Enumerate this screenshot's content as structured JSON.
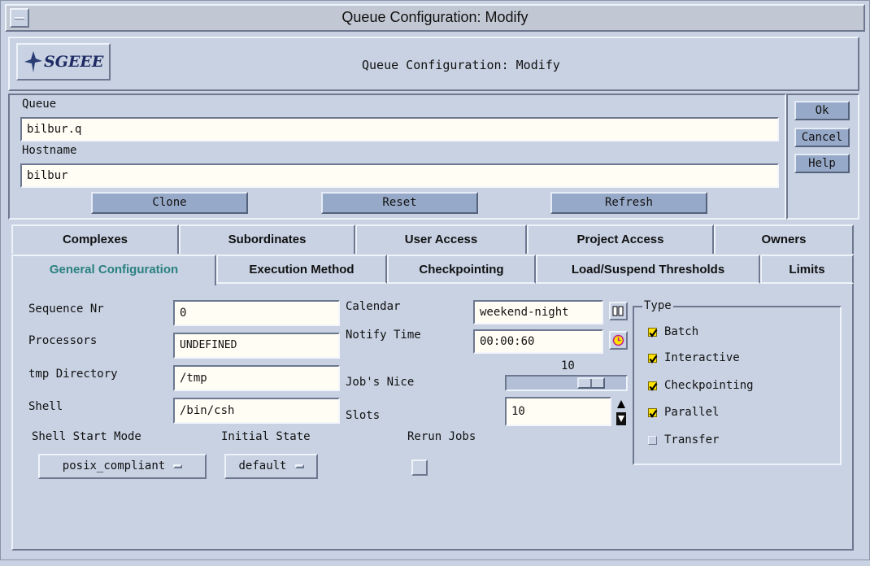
{
  "window": {
    "title": "Queue Configuration: Modify"
  },
  "header": {
    "logo_text": "SGEEE",
    "title": "Queue Configuration: Modify"
  },
  "form": {
    "queue_label": "Queue",
    "queue_value": "bilbur.q",
    "hostname_label": "Hostname",
    "hostname_value": "bilbur"
  },
  "form_buttons": {
    "clone": "Clone",
    "reset": "Reset",
    "refresh": "Refresh"
  },
  "side_buttons": {
    "ok": "Ok",
    "cancel": "Cancel",
    "help": "Help"
  },
  "tabs_row1": [
    "Complexes",
    "Subordinates",
    "User Access",
    "Project Access",
    "Owners"
  ],
  "tabs_row2": [
    "General Configuration",
    "Execution Method",
    "Checkpointing",
    "Load/Suspend Thresholds",
    "Limits"
  ],
  "active_tab": "General Configuration",
  "colors": {
    "active_tab_text": "#2a8080",
    "checkbox_on": "#ffe200",
    "button_bg": "#97a9c8",
    "panel_bg": "#c8d2e3"
  },
  "general": {
    "sequence_nr_label": "Sequence Nr",
    "sequence_nr_value": "0",
    "processors_label": "Processors",
    "processors_value": "UNDEFINED",
    "tmp_dir_label": "tmp Directory",
    "tmp_dir_value": "/tmp",
    "shell_label": "Shell",
    "shell_value": "/bin/csh",
    "calendar_label": "Calendar",
    "calendar_value": "weekend-night",
    "notify_time_label": "Notify Time",
    "notify_time_value": "00:00:60",
    "jobs_nice_label": "Job's Nice",
    "jobs_nice_value": "10",
    "slots_label": "Slots",
    "slots_value": "10",
    "shell_start_mode_label": "Shell Start Mode",
    "shell_start_mode_value": "posix_compliant",
    "initial_state_label": "Initial State",
    "initial_state_value": "default",
    "rerun_jobs_label": "Rerun Jobs",
    "rerun_jobs_checked": false
  },
  "type_group": {
    "label": "Type",
    "items": [
      {
        "label": "Batch",
        "checked": true
      },
      {
        "label": "Interactive",
        "checked": true
      },
      {
        "label": "Checkpointing",
        "checked": true
      },
      {
        "label": "Parallel",
        "checked": true
      },
      {
        "label": "Transfer",
        "checked": false
      }
    ]
  },
  "icons": {
    "calendar_button": "calendar-icon",
    "notify_button": "clock-icon",
    "spin_up": "arrow-up-icon",
    "spin_down": "arrow-down-icon"
  }
}
